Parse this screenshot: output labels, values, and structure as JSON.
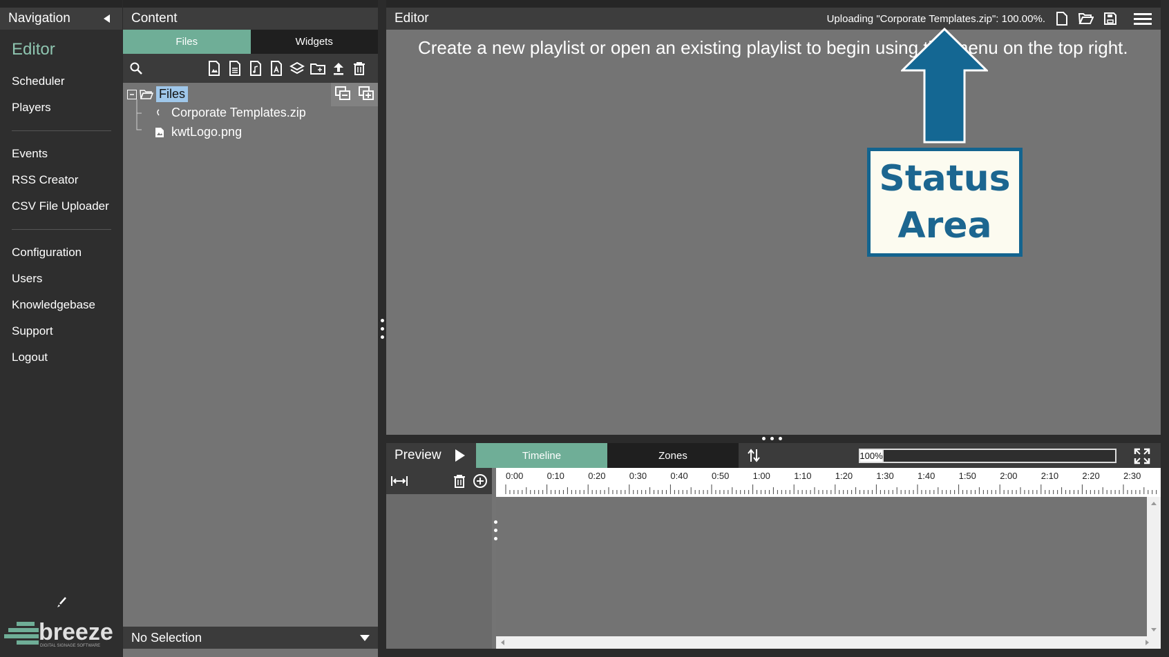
{
  "navigation": {
    "title": "Navigation",
    "items_group1": [
      "Editor",
      "Scheduler",
      "Players"
    ],
    "items_group2": [
      "Events",
      "RSS Creator",
      "CSV File Uploader"
    ],
    "items_group3": [
      "Configuration",
      "Users",
      "Knowledgebase",
      "Support",
      "Logout"
    ],
    "active": "Editor",
    "logo_text": "breeze",
    "logo_subtext": "DIGITAL SIGNAGE SOFTWARE"
  },
  "content": {
    "title": "Content",
    "tabs": [
      "Files",
      "Widgets"
    ],
    "active_tab": "Files",
    "tree": {
      "root": "Files",
      "children": [
        "Corporate Templates.zip",
        "kwtLogo.png"
      ]
    },
    "selection": "No Selection"
  },
  "editor": {
    "title": "Editor",
    "status": "Uploading \"Corporate Templates.zip\": 100.00%.",
    "message": "Create a new playlist or open an existing playlist to begin using the menu on the top right.",
    "callout": {
      "line1": "Status",
      "line2": "Area"
    }
  },
  "preview": {
    "title": "Preview",
    "tabs": [
      "Timeline",
      "Zones"
    ],
    "active_tab": "Timeline",
    "zoom": "100%",
    "ticks": [
      "0:00",
      "0:10",
      "0:20",
      "0:30",
      "0:40",
      "0:50",
      "1:00",
      "1:10",
      "1:20",
      "1:30",
      "1:40",
      "1:50",
      "2:00",
      "2:10",
      "2:20",
      "2:30"
    ]
  },
  "colors": {
    "accent": "#6fae97",
    "nav_active": "#8ec5b0",
    "callout_blue": "#13648f",
    "selection": "#9fc7ea"
  }
}
